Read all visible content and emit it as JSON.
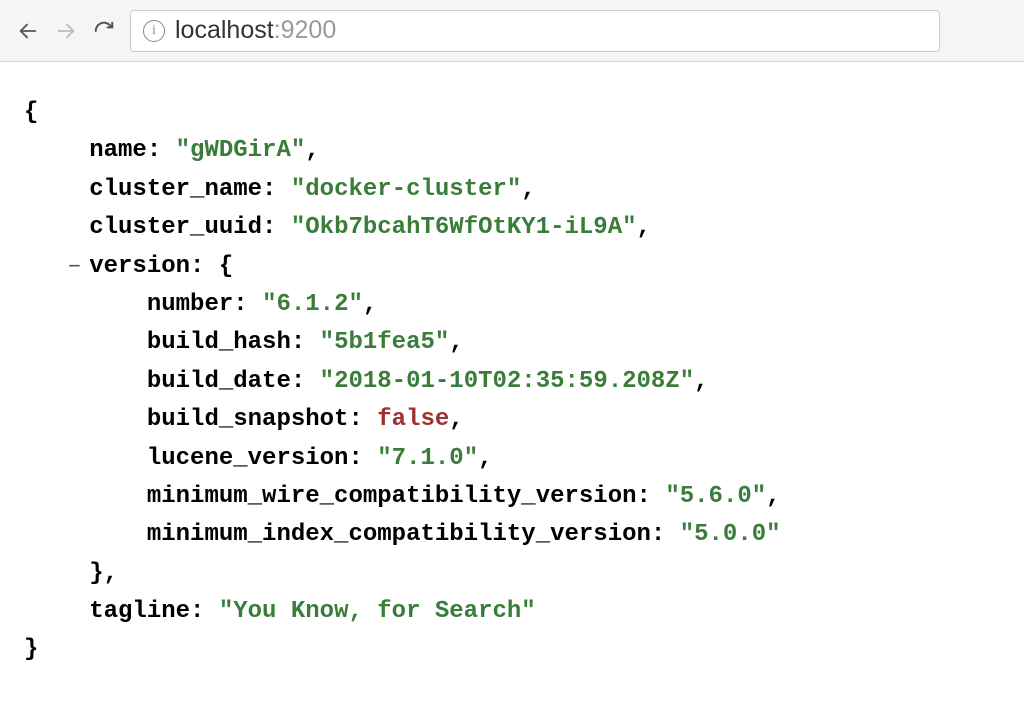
{
  "toolbar": {
    "url_host": "localhost",
    "url_port": ":9200",
    "info_glyph": "i"
  },
  "json": {
    "open_brace": "{",
    "close_brace": "}",
    "name_key": "name:",
    "name_val": "\"gWDGirA\"",
    "cluster_name_key": "cluster_name:",
    "cluster_name_val": "\"docker-cluster\"",
    "cluster_uuid_key": "cluster_uuid:",
    "cluster_uuid_val": "\"Okb7bcahT6WfOtKY1-iL9A\"",
    "version_key": "version:",
    "version_open": "{",
    "version_close": "},",
    "number_key": "number:",
    "number_val": "\"6.1.2\"",
    "build_hash_key": "build_hash:",
    "build_hash_val": "\"5b1fea5\"",
    "build_date_key": "build_date:",
    "build_date_val": "\"2018-01-10T02:35:59.208Z\"",
    "build_snapshot_key": "build_snapshot:",
    "build_snapshot_val": "false",
    "lucene_version_key": "lucene_version:",
    "lucene_version_val": "\"7.1.0\"",
    "min_wire_key": "minimum_wire_compatibility_version:",
    "min_wire_val": "\"5.6.0\"",
    "min_index_key": "minimum_index_compatibility_version:",
    "min_index_val": "\"5.0.0\"",
    "tagline_key": "tagline:",
    "tagline_val": "\"You Know, for Search\"",
    "collapse_glyph": "–",
    "comma": ","
  }
}
